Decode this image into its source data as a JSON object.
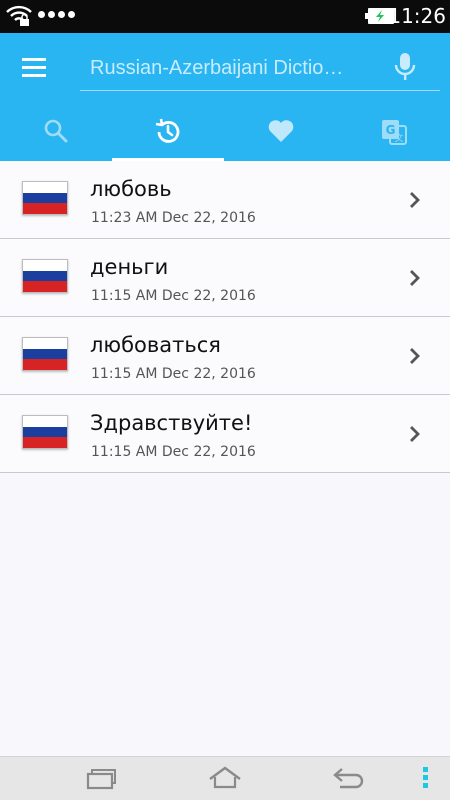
{
  "status_bar": {
    "time": "11:26",
    "icons": [
      "wifi-icon",
      "signal-dots-icon",
      "battery-charging-icon"
    ]
  },
  "toolbar": {
    "menu_icon": "hamburger-menu-icon",
    "search_placeholder": "Russian-Azerbaijani Dictio…",
    "mic_icon": "microphone-icon",
    "accent_color": "#29b4f2"
  },
  "tabs": [
    {
      "name": "search",
      "icon": "search-icon",
      "active": false
    },
    {
      "name": "history",
      "icon": "history-icon",
      "active": true
    },
    {
      "name": "favorites",
      "icon": "heart-icon",
      "active": false
    },
    {
      "name": "translate",
      "icon": "translate-icon",
      "active": false
    }
  ],
  "history": [
    {
      "word": "любовь",
      "time": "11:23 AM Dec 22, 2016",
      "flag": "russia-flag-icon"
    },
    {
      "word": "деньги",
      "time": "11:15 AM Dec 22, 2016",
      "flag": "russia-flag-icon"
    },
    {
      "word": "любоваться",
      "time": "11:15 AM Dec 22, 2016",
      "flag": "russia-flag-icon"
    },
    {
      "word": "Здравствуйте!",
      "time": "11:15 AM Dec 22, 2016",
      "flag": "russia-flag-icon"
    }
  ],
  "nav_bar": {
    "icons": [
      "recent-apps-icon",
      "home-icon",
      "back-icon",
      "more-options-icon"
    ]
  }
}
